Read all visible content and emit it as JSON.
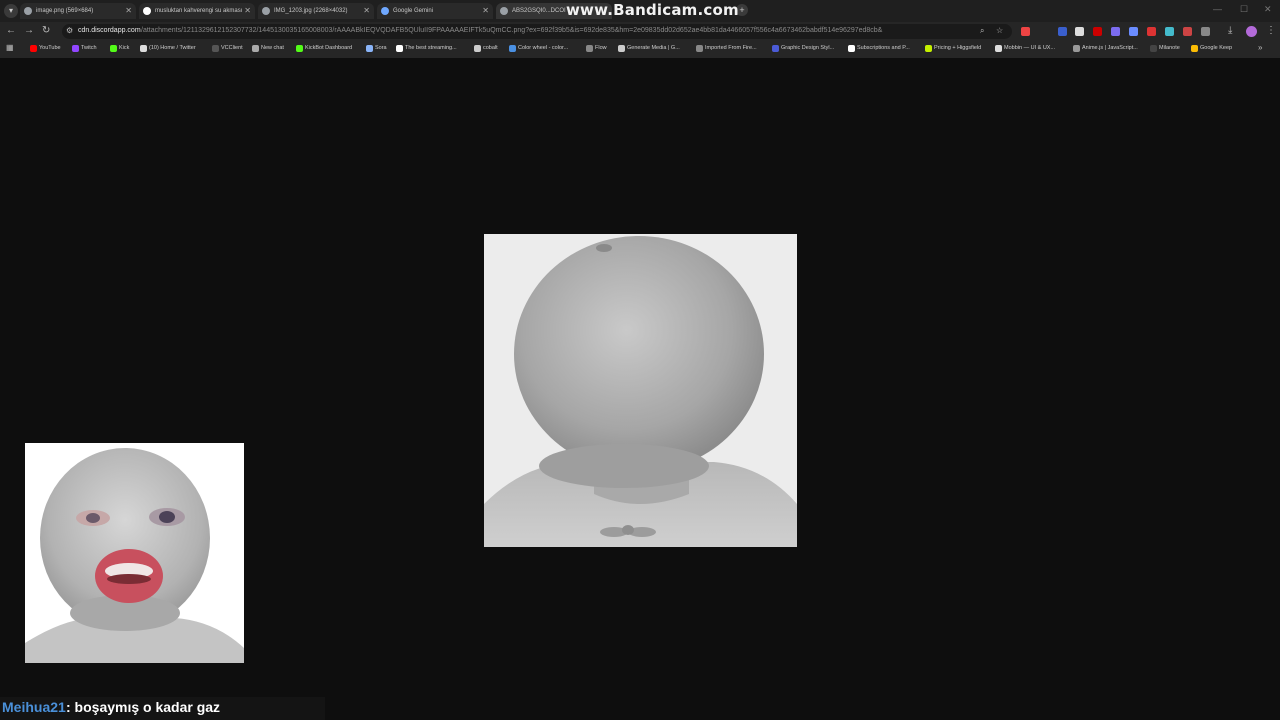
{
  "watermark": "www.Bandicam.com",
  "tabs": [
    {
      "label": "image.png (569×684)"
    },
    {
      "label": "musluktan kahverengi su akması"
    },
    {
      "label": "IMG_1203.jpg (2268×4032)"
    },
    {
      "label": "Google Gemini"
    },
    {
      "label": "ABS2GSQI0...DCOI"
    }
  ],
  "address": {
    "host": "cdn.discordapp.com",
    "path": "/attachments/1211329612152307732/1445130035165008003/rAAAABkIEQVQDAFB5QUluII9FPAAAAAEIFTk5uQmCC.png?ex=692f39b5&is=692de835&hm=2e09835dd02d652ae4bb81da4466057f556c4a6673462babdf514e96297ed8cb&"
  },
  "bookmarks": [
    {
      "label": "YouTube"
    },
    {
      "label": "Twitch"
    },
    {
      "label": "Kick"
    },
    {
      "label": "(10) Home / Twitter"
    },
    {
      "label": "VCClient"
    },
    {
      "label": "New chat"
    },
    {
      "label": "KickBot Dashboard"
    },
    {
      "label": "Sora"
    },
    {
      "label": "The best streaming..."
    },
    {
      "label": "cobalt"
    },
    {
      "label": "Color wheel - color..."
    },
    {
      "label": "Flow"
    },
    {
      "label": "Generate Media | G..."
    },
    {
      "label": "Imported From Fire..."
    },
    {
      "label": "Graphic Design Styl..."
    },
    {
      "label": "Subscriptions and P..."
    },
    {
      "label": "Pricing + Higgsfield"
    },
    {
      "label": "Mobbin — UI & UX..."
    },
    {
      "label": "Anime.js | JavaScript..."
    },
    {
      "label": "Milanote"
    },
    {
      "label": "Google Keep"
    }
  ],
  "chat": {
    "username": "Meihua21",
    "message": ": boşaymış o kadar gaz"
  },
  "colors": {
    "page_bg": "#0e0e0e",
    "chat_user": "#4a90d9"
  }
}
